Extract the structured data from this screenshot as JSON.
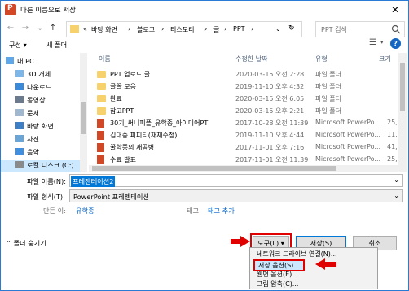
{
  "window": {
    "title": "다른 이름으로 저장",
    "close_glyph": "✕"
  },
  "nav": {
    "back": "←",
    "forward": "→",
    "up": "↑",
    "crumbs": [
      "«",
      "바탕 화면",
      "›",
      "블로그",
      "›",
      "티스토리",
      "›",
      "글",
      "›",
      "PPT",
      "›"
    ],
    "search_placeholder": "PPT 검색"
  },
  "toolbar": {
    "organize": "구성 ▾",
    "new_folder": "새 폴더"
  },
  "sidebar": {
    "items": [
      {
        "label": "내 PC",
        "icon": "pc-icon"
      },
      {
        "label": "3D 개체",
        "icon": "cube-icon"
      },
      {
        "label": "다운로드",
        "icon": "download-icon"
      },
      {
        "label": "동영상",
        "icon": "video-icon"
      },
      {
        "label": "문서",
        "icon": "document-icon"
      },
      {
        "label": "바탕 화면",
        "icon": "desktop-icon"
      },
      {
        "label": "사진",
        "icon": "picture-icon"
      },
      {
        "label": "음악",
        "icon": "music-icon"
      },
      {
        "label": "로컬 디스크 (C:)",
        "icon": "drive-icon"
      }
    ]
  },
  "file_list": {
    "columns": [
      "이름",
      "수정한 날짜",
      "유형",
      "크기"
    ],
    "rows": [
      {
        "name": "PPT 업로드 글",
        "date": "2020-03-15 오전 2:28",
        "type": "파일 폴더",
        "size": "",
        "kind": "folder"
      },
      {
        "name": "글꼴 모음",
        "date": "2019-11-10 오후 4:32",
        "type": "파일 폴더",
        "size": "",
        "kind": "folder"
      },
      {
        "name": "완료",
        "date": "2020-03-15 오전 6:05",
        "type": "파일 폴더",
        "size": "",
        "kind": "folder"
      },
      {
        "name": "참고PPT",
        "date": "2020-03-15 오후 2:21",
        "type": "파일 폴더",
        "size": "",
        "kind": "folder"
      },
      {
        "name": "30기_써니피플_유학종_아이디어PT",
        "date": "2017-10-28 오전 11:39",
        "type": "Microsoft PowerPo...",
        "size": "25,5",
        "kind": "ppt"
      },
      {
        "name": "김대중 피피티(재재수정)",
        "date": "2019-11-10 오후 4:44",
        "type": "Microsoft PowerPo...",
        "size": "11,9",
        "kind": "ppt"
      },
      {
        "name": "꿀학종의 재공병",
        "date": "2017-11-01 오후 7:16",
        "type": "Microsoft PowerPo...",
        "size": "41,5",
        "kind": "ppt"
      },
      {
        "name": "수료 발표",
        "date": "2017-11-01 오전 11:39",
        "type": "Microsoft PowerPo...",
        "size": "25,9",
        "kind": "ppt"
      }
    ]
  },
  "form": {
    "filename_label": "파일 이름(N):",
    "filename_value": "프레젠테이션2",
    "filetype_label": "파일 형식(T):",
    "filetype_value": "PowerPoint 프레젠테이션",
    "author_label": "만든 이:",
    "author_value": "유학종",
    "tags_label": "태그:",
    "tags_value": "태그 추가"
  },
  "footer": {
    "hide_folders": "폴더 숨기기",
    "tools": "도구(L) ▾",
    "save": "저장(S)",
    "cancel": "취소"
  },
  "menu": {
    "items": [
      "네트워크 드라이브 연결(N)...",
      "저장 옵션(S)...",
      "웹면 옵션(E)...",
      "그림 압축(C)..."
    ]
  },
  "colors": {
    "accent": "#0078d7",
    "highlight_red": "#e00000",
    "folder": "#f7d16b",
    "ppt": "#d24726"
  }
}
